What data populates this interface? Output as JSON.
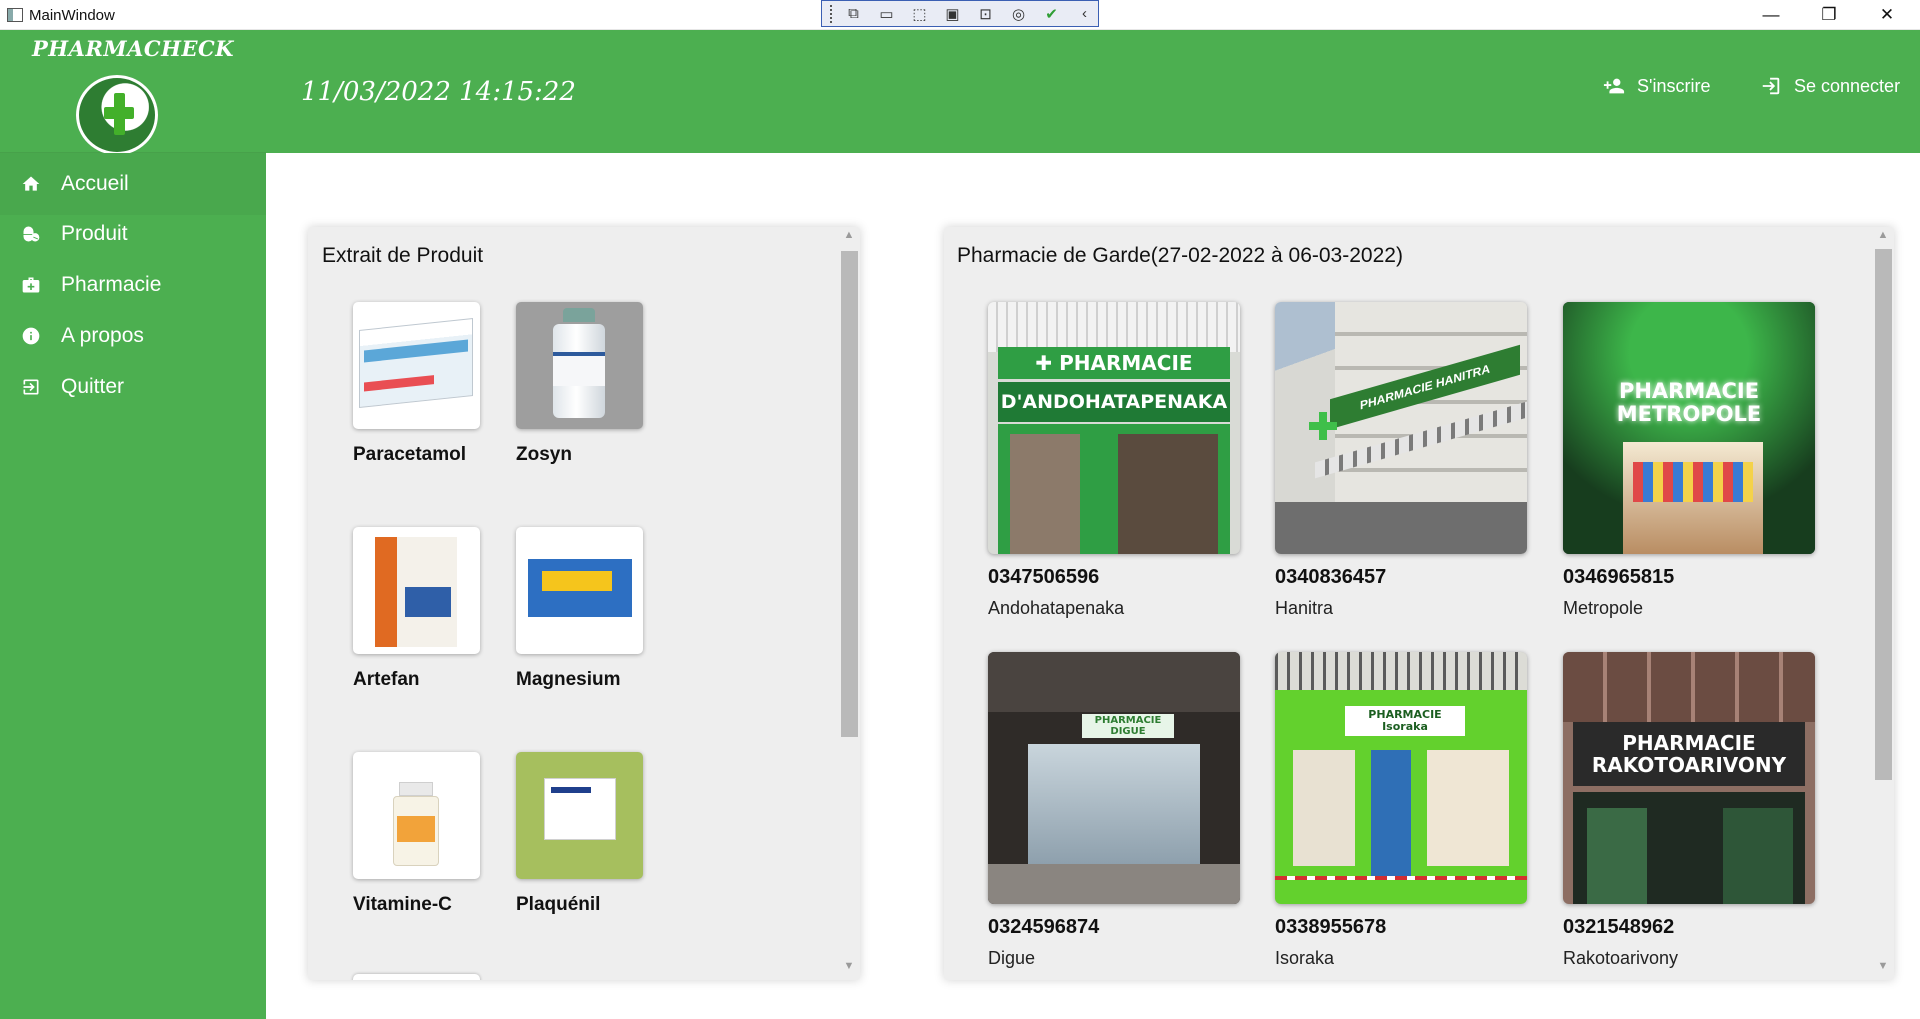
{
  "window": {
    "title": "MainWindow",
    "controls": {
      "minimize": "—",
      "maximize": "❐",
      "close": "✕"
    }
  },
  "debug_toolbar": {
    "icons": [
      "live-visual-tree-icon",
      "record-icon",
      "select-element-icon",
      "display-layout-adorners-icon",
      "track-focus-icon",
      "binding-failures-icon",
      "hot-reload-ok-icon",
      "collapse-icon"
    ]
  },
  "sidebar": {
    "brand": "PHARMACHECK",
    "logo_icon": "pharmacy-cross-logo",
    "items": [
      {
        "label": "Accueil",
        "icon": "home-icon",
        "active": true
      },
      {
        "label": "Produit",
        "icon": "pill-icon",
        "active": false
      },
      {
        "label": "Pharmacie",
        "icon": "medical-bag-icon",
        "active": false
      },
      {
        "label": "A propos",
        "icon": "info-icon",
        "active": false
      },
      {
        "label": "Quitter",
        "icon": "exit-icon",
        "active": false
      }
    ]
  },
  "header": {
    "datetime": "11/03/2022 14:15:22",
    "register_label": "S'inscrire",
    "login_label": "Se connecter"
  },
  "products_panel": {
    "title": "Extrait de Produit",
    "items": [
      {
        "name": "Paracetamol"
      },
      {
        "name": "Zosyn"
      },
      {
        "name": "Artefan"
      },
      {
        "name": "Magnesium"
      },
      {
        "name": "Vitamine-C"
      },
      {
        "name": "Plaquénil"
      }
    ]
  },
  "pharmacies_panel": {
    "title": "Pharmacie de Garde(27-02-2022 à 06-03-2022)",
    "items": [
      {
        "phone": "0347506596",
        "name": "Andohatapenaka",
        "sign_top": "✚ PHARMACIE",
        "sign_bottom": "D'ANDOHATAPENAKA"
      },
      {
        "phone": "0340836457",
        "name": "Hanitra",
        "sign": "PHARMACIE HANITRA"
      },
      {
        "phone": "0346965815",
        "name": "Metropole",
        "sign": "PHARMACIE\nMETROPOLE"
      },
      {
        "phone": "0324596874",
        "name": "Digue",
        "sign": "PHARMACIE DIGUE"
      },
      {
        "phone": "0338955678",
        "name": "Isoraka",
        "sign": "PHARMACIE Isoraka"
      },
      {
        "phone": "0321548962",
        "name": "Rakotoarivony",
        "sign": "PHARMACIE\nRAKOTOARIVONY"
      }
    ]
  },
  "colors": {
    "primary_green": "#4caf50",
    "panel_bg": "#eeeeee",
    "scroll_thumb": "#b9b9b9"
  }
}
